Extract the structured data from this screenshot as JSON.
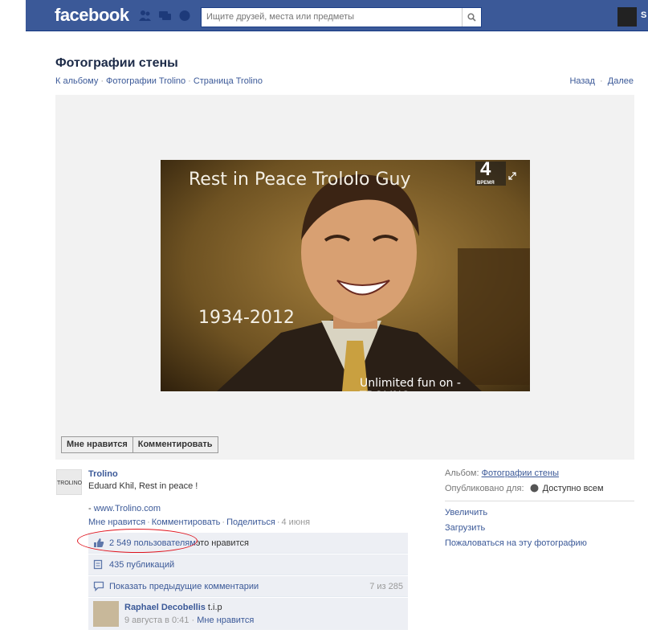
{
  "header": {
    "logo": "facebook",
    "search_placeholder": "Ищите друзей, места или предметы",
    "profile_initial": "S"
  },
  "page": {
    "title": "Фотографии стены",
    "breadcrumb": [
      "К альбому",
      "Фотографии Trolino",
      "Страница Trolino"
    ],
    "prev": "Назад",
    "next": "Далее"
  },
  "photo": {
    "caption_top": "Rest in Peace Trololo Guy",
    "years": "1934-2012",
    "watermark": "Unlimited fun on -TROLINO.com",
    "channel_number": "4",
    "channel_label": "ВРЕМЯ"
  },
  "actions": {
    "like": "Мне нравится",
    "comment": "Комментировать"
  },
  "post": {
    "author": "Trolino",
    "avatar_text": "TROLINO",
    "text": "Eduard Khil, Rest in peace !",
    "link_prefix": "- ",
    "link": "www.Trolino.com",
    "meta": {
      "like": "Мне нравится",
      "comment": "Комментировать",
      "share": "Поделиться",
      "date": "4 июня"
    }
  },
  "ufi": {
    "likes_link": "2 549 пользователям",
    "likes_suffix": " это нравится",
    "shares": "435 публикаций",
    "show_prev": "Показать предыдущие комментарии",
    "count": "7 из 285"
  },
  "comment": {
    "name": "Raphael Decobellis",
    "text": " t.i.p",
    "time": "9 августа в 0:41",
    "like": "Мне нравится"
  },
  "side": {
    "album_label": "Альбом:",
    "album_link": "Фотографии стены",
    "published_label": "Опубликовано для:",
    "published_value": "Доступно всем",
    "links": [
      "Увеличить",
      "Загрузить",
      "Пожаловаться на эту фотографию"
    ]
  },
  "colors": {
    "brand": "#3b5998",
    "annotation": "#e0141e"
  }
}
